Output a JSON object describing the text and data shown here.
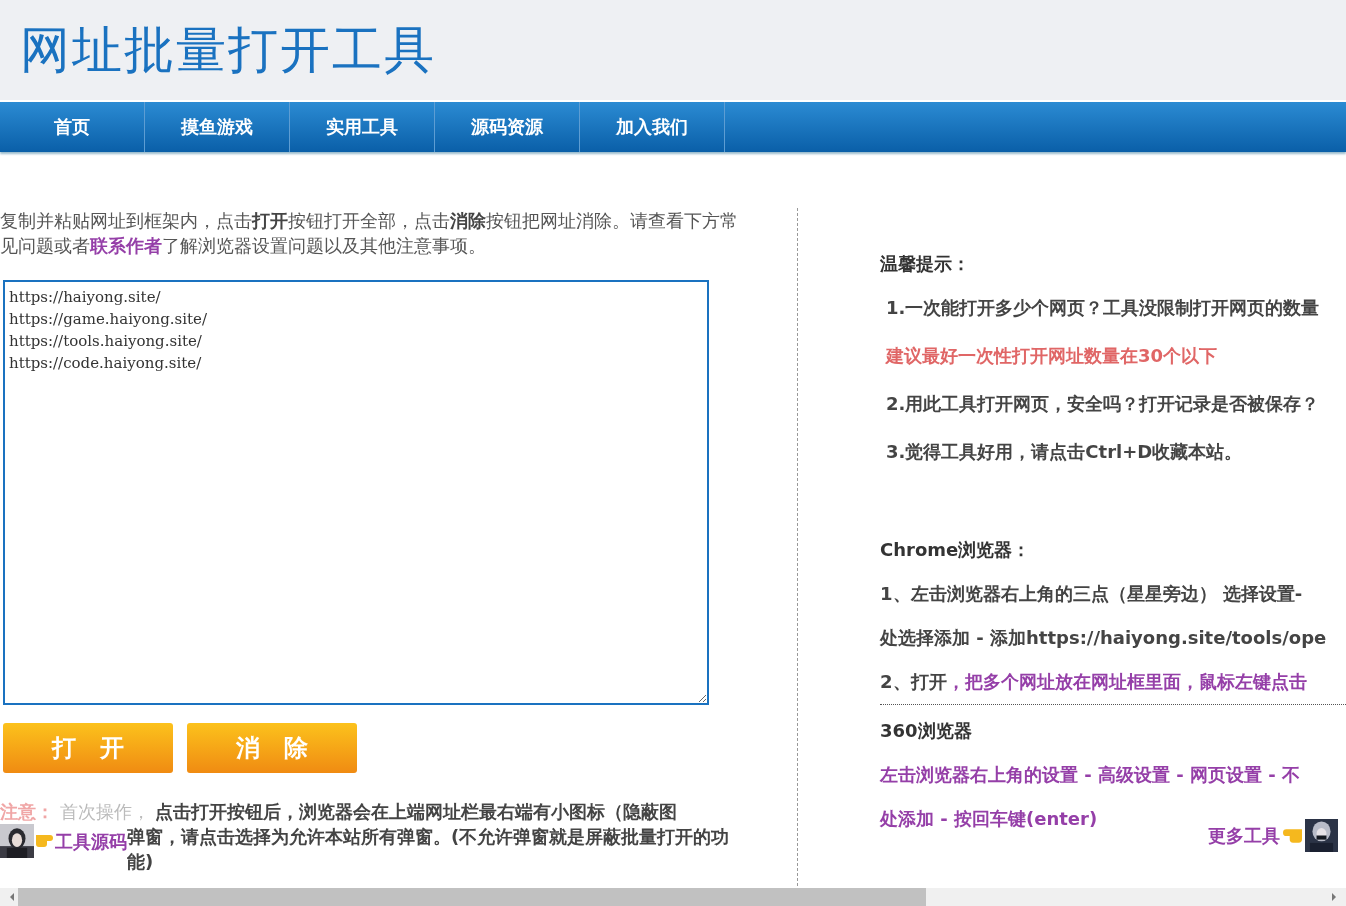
{
  "site_title": "网址批量打开工具",
  "nav": [
    {
      "label": "首页"
    },
    {
      "label": "摸鱼游戏"
    },
    {
      "label": "实用工具"
    },
    {
      "label": "源码资源"
    },
    {
      "label": "加入我们"
    }
  ],
  "intro": "复制并粘贴网址到框架内，点击**打开**按钮打开全部，点击**消除**按钮把网址消除。请查看下方常见问题或者",
  "intro_link": "联系作者",
  "intro_end": "了解浏览器设置问题以及其他注意事项。",
  "url_box": {
    "value": "https://haiyong.site/\nhttps://game.haiyong.site/\nhttps://tools.haiyong.site/\nhttps://code.haiyong.site/"
  },
  "buttons": [
    {
      "label": "打　开"
    },
    {
      "label": "消　除"
    }
  ],
  "notice": {
    "label": "注意：",
    "faint": "首次操作，",
    "line1": "点击打开按钮后，浏览器会在上端网址栏最右端有小图标（隐蔽图",
    "line2": "弹窗，请点击选择为允许本站所有弹窗。(不允许弹窗就是屏蔽批量打开的功能)"
  },
  "source_widget": {
    "label": "工具源码"
  },
  "tips": {
    "title": "温馨提示：",
    "items": [
      {
        "kind": "normal",
        "text": "1.一次能打开多少个网页？工具没限制打开网页的数量"
      },
      {
        "kind": "warning",
        "text": "建议最好一次性打开网址数量在30个以下"
      },
      {
        "kind": "normal",
        "text": "2.用此工具打开网页，安全吗？打开记录是否被保存？"
      },
      {
        "kind": "normal",
        "text": "3.觉得工具好用，请点击Ctrl+D收藏本站。"
      }
    ]
  },
  "chrome": {
    "title": "Chrome浏览器：",
    "lines": [
      {
        "parts": [
          {
            "kind": "plain",
            "text": "1、左击浏览器右上角的三点（星星旁边） 选择设置-"
          }
        ]
      },
      {
        "parts": [
          {
            "kind": "plain",
            "text": "处选择添加 - 添加https://haiyong.site/tools/ope"
          }
        ]
      },
      {
        "parts": [
          {
            "kind": "plain",
            "text": "2、打开"
          },
          {
            "kind": "link",
            "text": "，把多个网址放在网址框里面，鼠标左键点击"
          }
        ]
      }
    ]
  },
  "browser360": {
    "title": "360浏览器",
    "lines": [
      "左击浏览器右上角的设置 - 高级设置 - 网页设置 - 不",
      "处添加 - 按回车键(enter)"
    ]
  },
  "more_tools": {
    "label": "更多工具"
  }
}
